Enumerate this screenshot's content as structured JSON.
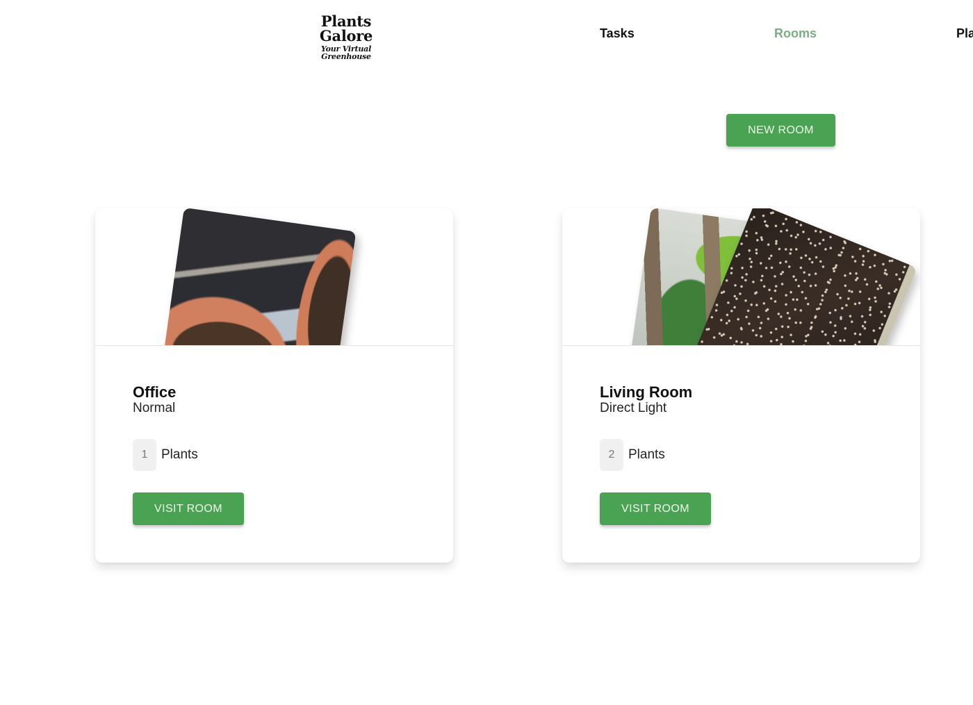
{
  "header": {
    "logo_title": "Plants Galore",
    "logo_subtitle": "Your Virtual Greenhouse",
    "nav": [
      {
        "label": "Tasks",
        "active": false
      },
      {
        "label": "Rooms",
        "active": true
      },
      {
        "label": "Plants",
        "active": false
      }
    ]
  },
  "actions": {
    "new_room_label": "NEW ROOM"
  },
  "rooms": [
    {
      "name": "Office",
      "light": "Normal",
      "plant_count": "1",
      "plants_label": "Plants",
      "visit_label": "VISIT ROOM",
      "photos": [
        "terracotta-pots-photo"
      ]
    },
    {
      "name": "Living Room",
      "light": "Direct Light",
      "plant_count": "2",
      "plants_label": "Plants",
      "visit_label": "VISIT ROOM",
      "photos": [
        "houseplants-photo",
        "potting-soil-photo"
      ]
    }
  ],
  "colors": {
    "accent": "#4aa352",
    "nav_active": "#7aae83",
    "badge_bg": "#f0f0f0"
  }
}
